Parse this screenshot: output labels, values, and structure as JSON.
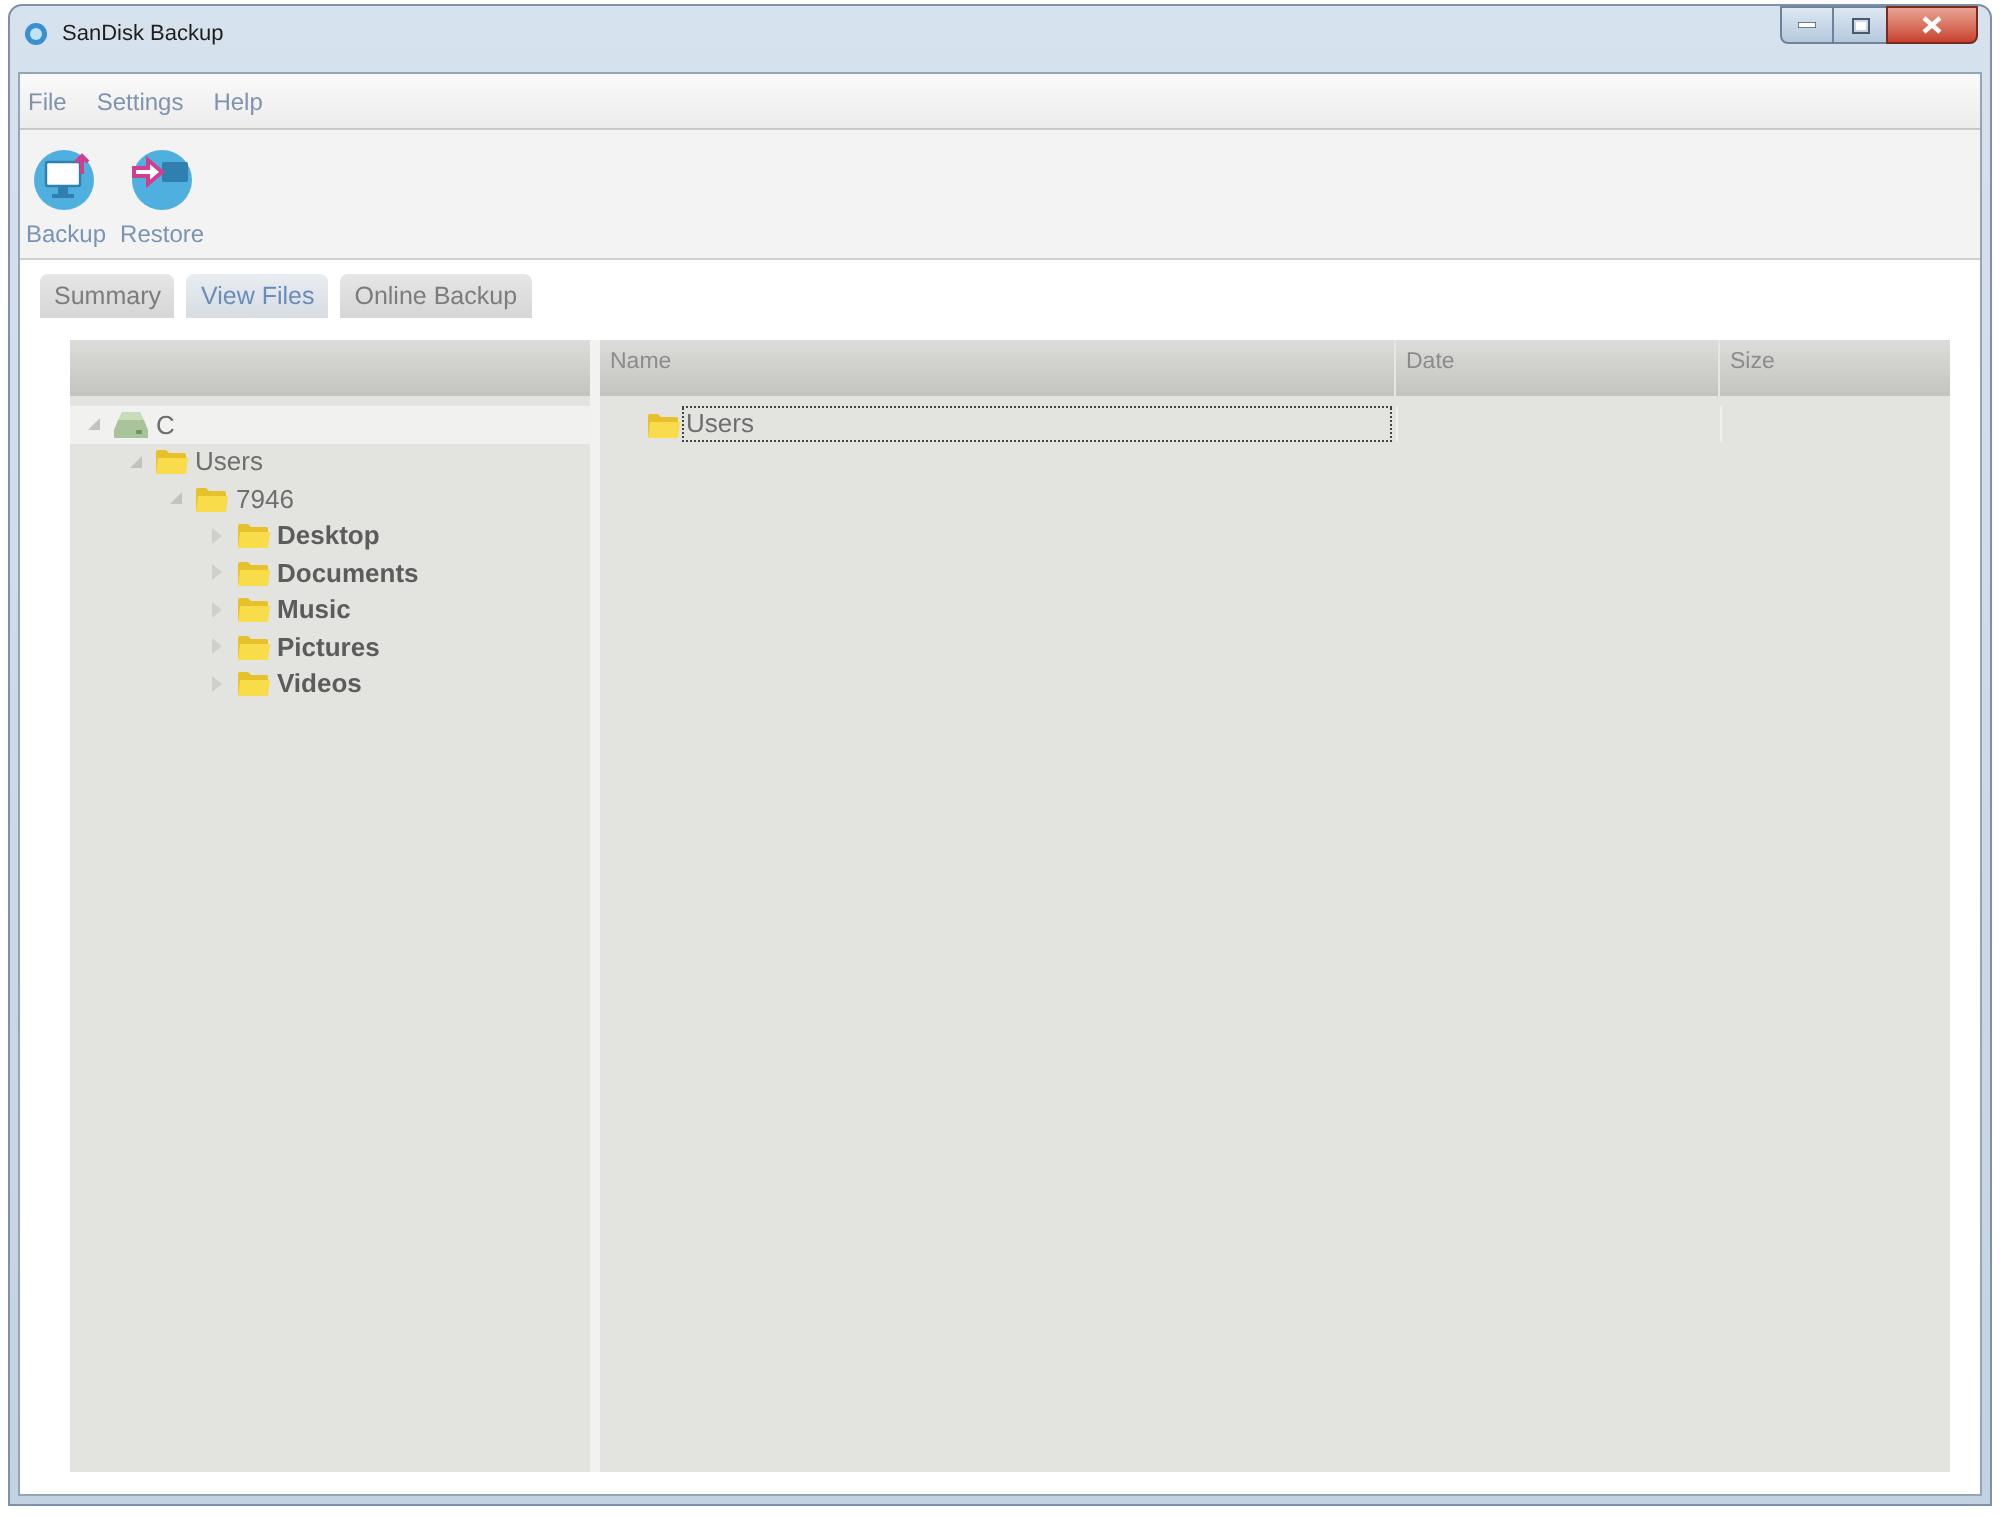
{
  "window": {
    "title": "SanDisk Backup"
  },
  "menu": [
    "File",
    "Settings",
    "Help"
  ],
  "toolbar": [
    {
      "label": "Backup",
      "kind": "backup"
    },
    {
      "label": "Restore",
      "kind": "restore"
    }
  ],
  "tabs": [
    {
      "label": "Summary",
      "selected": false
    },
    {
      "label": "View Files",
      "selected": true
    },
    {
      "label": "Online Backup",
      "selected": false
    }
  ],
  "tree": {
    "items": [
      {
        "label": "C",
        "kind": "drive",
        "expanded": true,
        "selected": true,
        "bold": false,
        "children": [
          {
            "label": "Users",
            "kind": "folder",
            "expanded": true,
            "selected": false,
            "bold": false,
            "children": [
              {
                "label": "7946",
                "kind": "folder",
                "expanded": true,
                "selected": false,
                "bold": false,
                "children": [
                  {
                    "label": "Desktop",
                    "kind": "folder",
                    "expanded": false,
                    "selected": false,
                    "bold": true
                  },
                  {
                    "label": "Documents",
                    "kind": "folder",
                    "expanded": false,
                    "selected": false,
                    "bold": true
                  },
                  {
                    "label": "Music",
                    "kind": "folder",
                    "expanded": false,
                    "selected": false,
                    "bold": true
                  },
                  {
                    "label": "Pictures",
                    "kind": "folder",
                    "expanded": false,
                    "selected": false,
                    "bold": true
                  },
                  {
                    "label": "Videos",
                    "kind": "folder",
                    "expanded": false,
                    "selected": false,
                    "bold": true
                  }
                ]
              }
            ]
          }
        ]
      }
    ]
  },
  "file_list": {
    "columns": [
      "Name",
      "Date",
      "Size"
    ],
    "rows": [
      {
        "name": "Users",
        "kind": "folder",
        "focused": true
      }
    ]
  }
}
